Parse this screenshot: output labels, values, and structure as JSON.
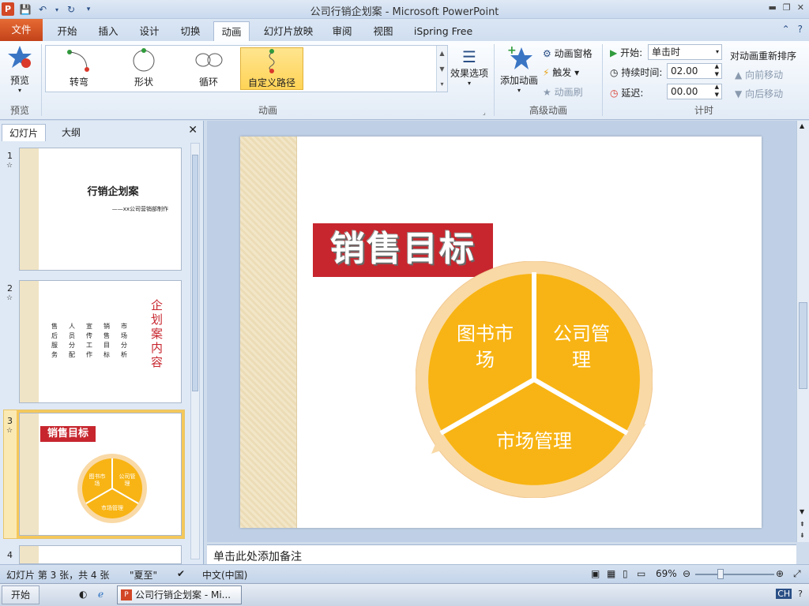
{
  "window": {
    "title": "公司行销企划案 - Microsoft PowerPoint",
    "app_icon": "P"
  },
  "ribbon_tabs": [
    "文件",
    "开始",
    "插入",
    "设计",
    "切换",
    "动画",
    "幻灯片放映",
    "审阅",
    "视图",
    "iSpring Free"
  ],
  "active_tab": "动画",
  "ribbon": {
    "preview": {
      "label": "预览",
      "group": "预览"
    },
    "animation_gallery": [
      "转弯",
      "形状",
      "循环",
      "自定义路径"
    ],
    "animation_group": "动画",
    "effect_options": "效果选项",
    "add_animation": "添加动画",
    "animation_pane": "动画窗格",
    "trigger": "触发",
    "animation_painter": "动画刷",
    "advanced_group": "高级动画",
    "start_label": "开始:",
    "start_value": "单击时",
    "duration_label": "持续时间:",
    "duration_value": "02.00",
    "delay_label": "延迟:",
    "delay_value": "00.00",
    "reorder_title": "对动画重新排序",
    "move_earlier": "向前移动",
    "move_later": "向后移动",
    "timing_group": "计时"
  },
  "left_panel": {
    "tabs": [
      "幻灯片",
      "大纲"
    ],
    "thumbnails": [
      {
        "num": "1",
        "title": "行销企划案",
        "subtitle": "——xx公司营销部制作"
      },
      {
        "num": "2",
        "vertical_title": "企划案内容",
        "columns": [
          "售后服务",
          "人员分配",
          "宣传工作",
          "销售目标",
          "市场分析"
        ]
      },
      {
        "num": "3",
        "title": "销售目标"
      },
      {
        "num": "4"
      }
    ]
  },
  "slide": {
    "title": "销售目标",
    "segments": [
      "图书市场",
      "公司管理",
      "市场管理"
    ],
    "segment_lines": [
      [
        "图书市",
        "场"
      ],
      [
        "公司管",
        "理"
      ],
      [
        "市场管理"
      ]
    ],
    "colors": {
      "segment": "#f8b414",
      "ring": "#f9d9a6",
      "title_bg": "#c7262e"
    }
  },
  "notes_placeholder": "单击此处添加备注",
  "statusbar": {
    "slide_info": "幻灯片 第 3 张，共 4 张",
    "theme": "\"夏至\"",
    "language": "中文(中国)",
    "zoom": "69%"
  },
  "taskbar": {
    "start": "开始",
    "window_item": "公司行销企划案 - Mi...",
    "ime": "CH"
  }
}
